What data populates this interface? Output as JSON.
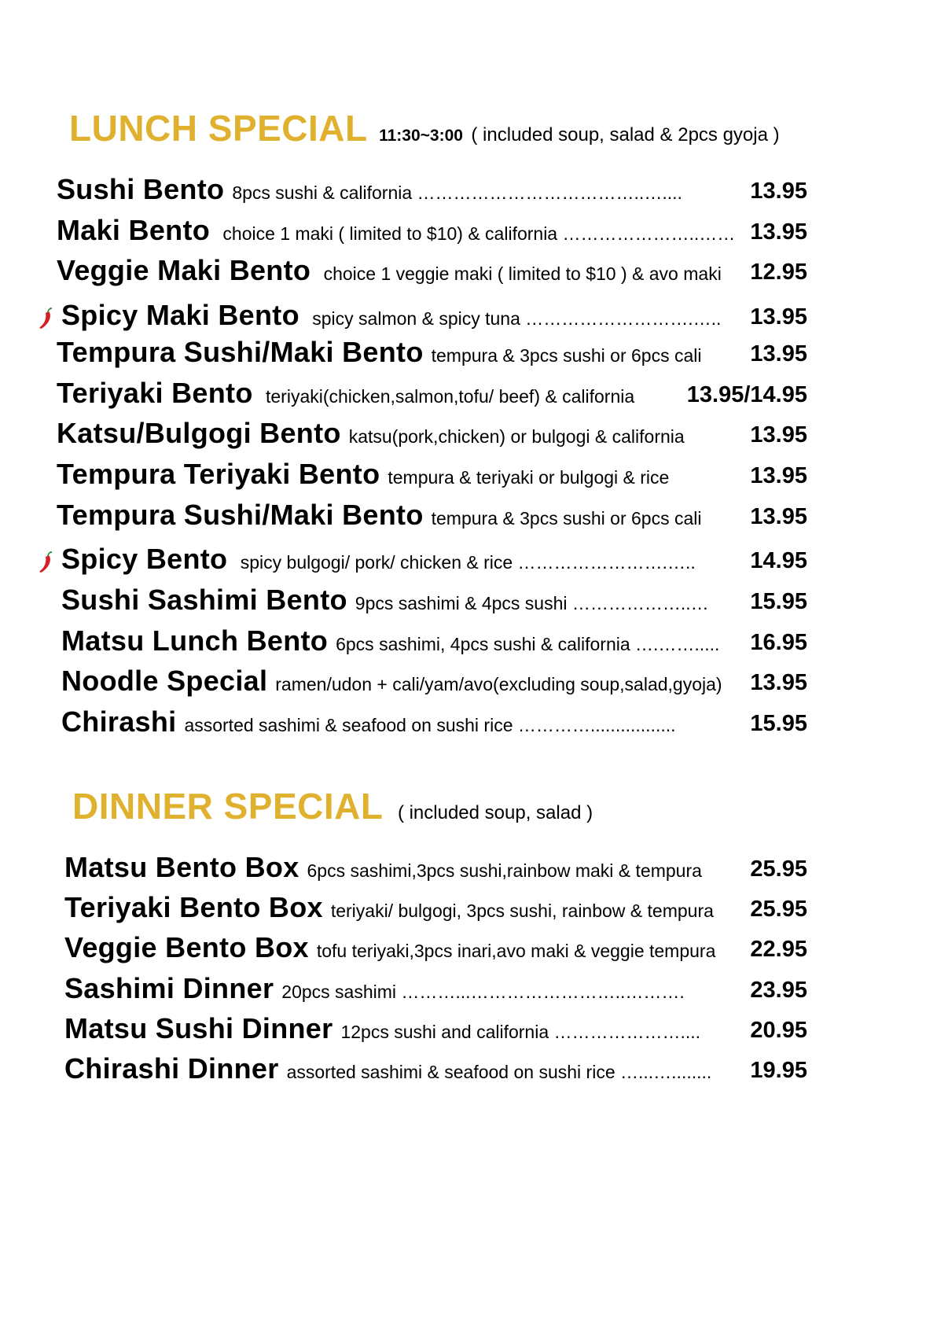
{
  "lunch": {
    "title": "LUNCH SPECIAL",
    "hours": "11:30~3:00",
    "note": "( included soup, salad & 2pcs gyoja  )",
    "items": [
      {
        "name": "Sushi Bento",
        "desc": "8pcs sushi & california ………………………………..…....",
        "price": "13.95"
      },
      {
        "name": "Maki Bento",
        "desc": " choice 1 maki ( limited to $10) & california …………………..……",
        "price": "13.95"
      },
      {
        "name": "Veggie Maki Bento",
        "desc": " choice 1 veggie maki ( limited to $10 ) & avo maki",
        "price": "12.95"
      },
      {
        "name": "Spicy Maki Bento",
        "desc": " spicy salmon & spicy tuna ……………………….…..",
        "price": "13.95",
        "spicy": true
      },
      {
        "name": "Tempura Sushi/Maki Bento",
        "desc": "tempura & 3pcs sushi or 6pcs cali",
        "price": "13.95"
      },
      {
        "name": "Teriyaki Bento",
        "desc": " teriyaki(chicken,salmon,tofu/ beef) & california",
        "price": "13.95/14.95"
      },
      {
        "name": "Katsu/Bulgogi Bento",
        "desc": "katsu(pork,chicken) or bulgogi & california",
        "price": "13.95"
      },
      {
        "name": "Tempura Teriyaki Bento",
        "desc": "tempura & teriyaki or bulgogi & rice",
        "price": "13.95"
      },
      {
        "name": "Tempura Sushi/Maki Bento",
        "desc": "tempura & 3pcs sushi or 6pcs cali",
        "price": "13.95"
      },
      {
        "name": "Spicy Bento",
        "desc": " spicy bulgogi/ pork/ chicken & rice  …………………….…..",
        "price": "14.95",
        "spicy": true
      },
      {
        "name": "Sushi Sashimi Bento",
        "desc": "9pcs sashimi & 4pcs sushi ………………..…",
        "price": "15.95"
      },
      {
        "name": "Matsu Lunch Bento",
        "desc": "6pcs sashimi, 4pcs sushi & california  ….…….....",
        "price": "16.95"
      },
      {
        "name": "Noodle Special",
        "desc": "ramen/udon + cali/yam/avo(excluding soup,salad,gyoja)",
        "price": "13.95"
      },
      {
        "name": "Chirashi",
        "desc": "assorted sashimi & seafood on sushi rice ………….................",
        "price": "15.95"
      }
    ]
  },
  "dinner": {
    "title": "DINNER SPECIAL",
    "note": "( included soup, salad )",
    "items": [
      {
        "name": "Matsu Bento Box",
        "desc": "6pcs sashimi,3pcs sushi,rainbow maki & tempura",
        "price": "25.95"
      },
      {
        "name": "Teriyaki Bento Box",
        "desc": "teriyaki/ bulgogi, 3pcs sushi, rainbow & tempura",
        "price": "25.95"
      },
      {
        "name": "Veggie Bento Box",
        "desc": "tofu teriyaki,3pcs inari,avo maki & veggie tempura",
        "price": "22.95"
      },
      {
        "name": "Sashimi Dinner",
        "desc": "20pcs sashimi ………...……………………..……….",
        "price": "23.95"
      },
      {
        "name": "Matsu Sushi Dinner",
        "desc": "12pcs sushi and california …………………....",
        "price": "20.95"
      },
      {
        "name": "Chirashi Dinner",
        "desc": "assorted sashimi & seafood on sushi rice …...…........",
        "price": "19.95"
      }
    ]
  },
  "colors": {
    "accent": "#e0b12e",
    "pepper": "#d41f26",
    "pepper_stem": "#2e8b3a"
  },
  "icons": {
    "spicy": "chili-pepper-icon"
  }
}
